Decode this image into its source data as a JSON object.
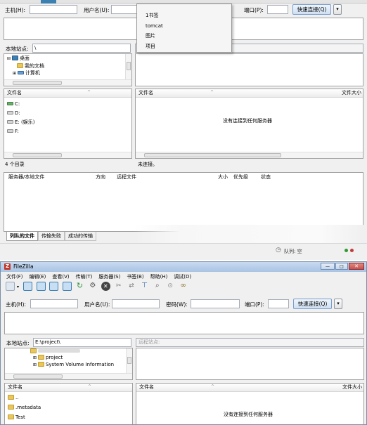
{
  "top": {
    "host_label": "主机(H):",
    "user_label": "用户名(U):",
    "port_label": "端口(P):",
    "quickconnect": "快速连接(Q)",
    "dropdown_arrow": "▾",
    "bookmarks": [
      "1书签",
      "tomcat",
      "图片",
      "项目"
    ],
    "local_site_label": "本地站点:",
    "local_site_value": "\\",
    "tree": [
      "桌面",
      "我的文档",
      "计算机"
    ],
    "local_header": "文件名",
    "remote_header": "文件名",
    "remote_size_header": "文件大小",
    "drives": [
      "C:",
      "D:",
      "E: (娱乐)",
      "F:"
    ],
    "status_left": "4 个目录",
    "status_right": "未连接。",
    "no_connection": "没有连接到任何服务器",
    "queue_headers": [
      "服务器/本地文件",
      "方向",
      "远程文件",
      "大小",
      "优先级",
      "状态"
    ],
    "queue_tabs": [
      "列队的文件",
      "传输失败",
      "成功的传输"
    ],
    "queue_status": "队列: 空"
  },
  "bottom": {
    "title": "FileZilla",
    "menu": [
      "文件(F)",
      "编辑(E)",
      "查看(V)",
      "传输(T)",
      "服务器(S)",
      "书签(B)",
      "帮助(H)",
      "调试(D)"
    ],
    "host_label": "主机(H):",
    "user_label": "用户名(U):",
    "pass_label": "密码(W):",
    "port_label": "端口(P):",
    "quickconnect": "快速连接(Q)",
    "local_site_label": "本地站点:",
    "local_site_value": "E:\\project\\",
    "remote_site_label": "远程站点:",
    "tree": [
      "project",
      "System Volume Information"
    ],
    "local_header": "文件名",
    "remote_header": "文件名",
    "remote_size_header": "文件大小",
    "files": [
      "..",
      ".metadata",
      "Test"
    ],
    "no_connection": "没有连接到任何服务器"
  },
  "colors": {
    "accent": "#3c7fb1",
    "titlebar": "#a9c4e4",
    "close": "#c75050"
  }
}
